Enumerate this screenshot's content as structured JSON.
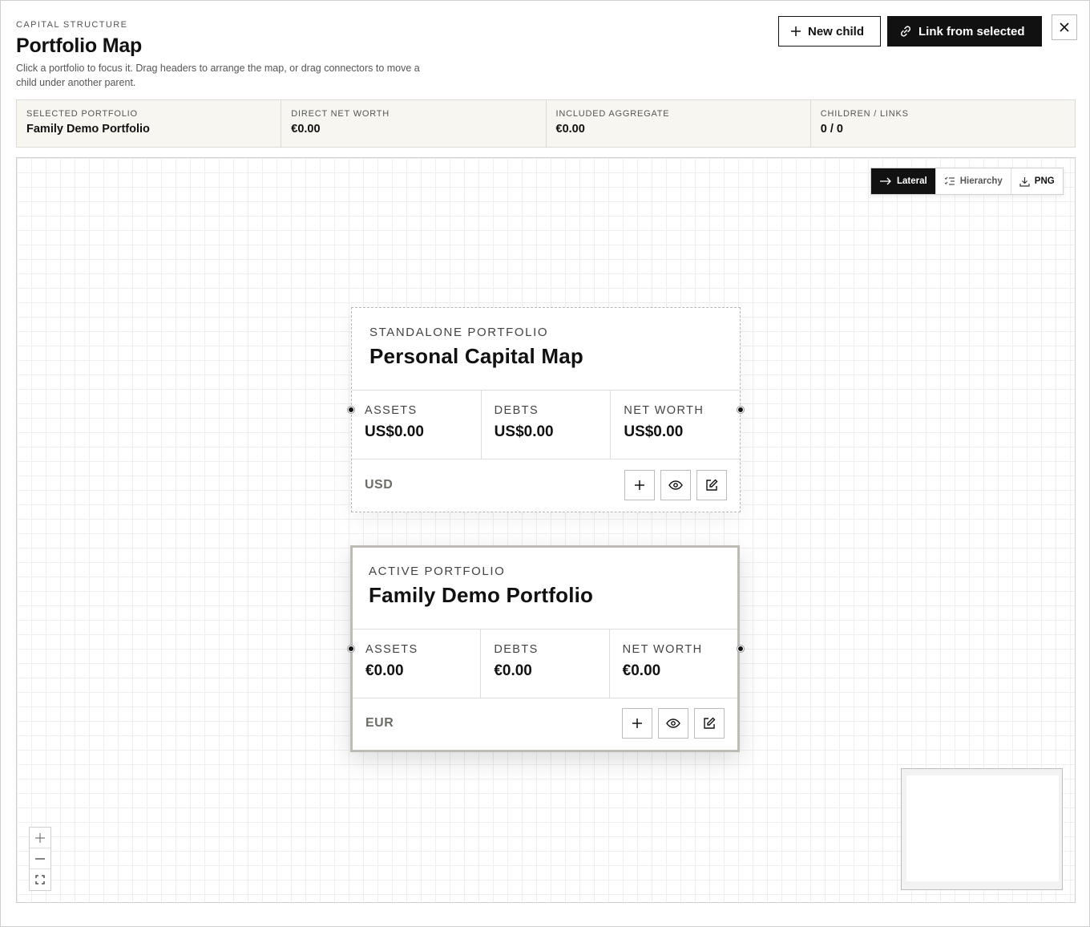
{
  "header": {
    "eyebrow": "CAPITAL STRUCTURE",
    "title": "Portfolio Map",
    "description": "Click a portfolio to focus it. Drag headers to arrange the map, or drag connectors to move a child under another parent.",
    "new_child_label": "New child",
    "link_label": "Link from selected"
  },
  "stats": [
    {
      "label": "SELECTED PORTFOLIO",
      "value": "Family Demo Portfolio"
    },
    {
      "label": "DIRECT NET WORTH",
      "value": "€0.00"
    },
    {
      "label": "INCLUDED AGGREGATE",
      "value": "€0.00"
    },
    {
      "label": "CHILDREN / LINKS",
      "value": "0 / 0"
    }
  ],
  "toolbar": {
    "lateral": "Lateral",
    "hierarchy": "Hierarchy",
    "png": "PNG",
    "active": "lateral"
  },
  "cards": [
    {
      "kicker": "STANDALONE PORTFOLIO",
      "name": "Personal Capital Map",
      "assets_label": "ASSETS",
      "assets": "US$0.00",
      "debts_label": "DEBTS",
      "debts": "US$0.00",
      "networth_label": "NET WORTH",
      "networth": "US$0.00",
      "currency": "USD"
    },
    {
      "kicker": "ACTIVE PORTFOLIO",
      "name": "Family Demo Portfolio",
      "assets_label": "ASSETS",
      "assets": "€0.00",
      "debts_label": "DEBTS",
      "debts": "€0.00",
      "networth_label": "NET WORTH",
      "networth": "€0.00",
      "currency": "EUR"
    }
  ],
  "icons": {
    "close": "close-icon",
    "plus": "plus-icon",
    "link": "link-icon",
    "view": "eye-icon",
    "edit": "edit-icon",
    "zoom_in": "zoom-in-icon",
    "zoom_out": "zoom-out-icon",
    "fit": "fit-view-icon",
    "download": "download-icon"
  },
  "colors": {
    "accent": "#111111",
    "panel_bg": "#f7f6f1",
    "active_border": "#bdbbb4",
    "currency_text": "#6e6c66"
  }
}
